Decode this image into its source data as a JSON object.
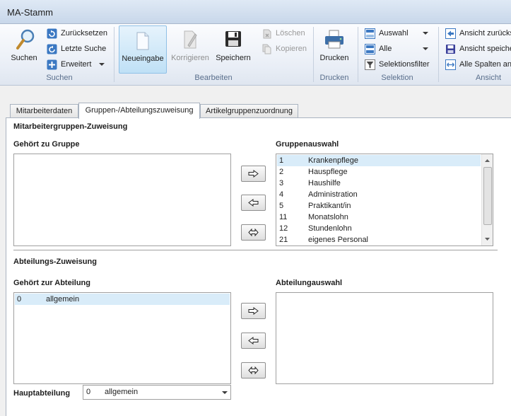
{
  "window": {
    "title": "MA-Stamm"
  },
  "ribbon": {
    "groups": {
      "suchen": "Suchen",
      "bearbeiten": "Bearbeiten",
      "drucken": "Drucken",
      "selektion": "Selektion",
      "ansicht": "Ansicht"
    },
    "buttons": {
      "suchen": "Suchen",
      "zuruecksetzen": "Zurücksetzen",
      "letzte_suche": "Letzte Suche",
      "erweitert": "Erweitert",
      "neueingabe": "Neueingabe",
      "korrigieren": "Korrigieren",
      "speichern": "Speichern",
      "loeschen": "Löschen",
      "kopieren": "Kopieren",
      "drucken": "Drucken",
      "auswahl": "Auswahl",
      "alle": "Alle",
      "selektionsfilter": "Selektionsfilter",
      "ansicht_zurueck": "Ansicht zurücks",
      "ansicht_speichern": "Ansicht speiche",
      "alle_spalten": "Alle Spalten an"
    }
  },
  "tabs": [
    {
      "label": "Mitarbeiterdaten"
    },
    {
      "label": "Gruppen-/Abteilungszuweisung"
    },
    {
      "label": "Artikelgruppenzuordnung"
    }
  ],
  "gruppen": {
    "section_title": "Mitarbeitergruppen-Zuweisung",
    "left_label": "Gehört zu Gruppe",
    "right_label": "Gruppenauswahl",
    "auswahl": [
      {
        "nr": "1",
        "name": "Krankenpflege"
      },
      {
        "nr": "2",
        "name": "Hauspflege"
      },
      {
        "nr": "3",
        "name": "Haushilfe"
      },
      {
        "nr": "4",
        "name": "Administration"
      },
      {
        "nr": "5",
        "name": "Praktikant/in"
      },
      {
        "nr": "11",
        "name": "Monatslohn"
      },
      {
        "nr": "12",
        "name": "Stundenlohn"
      },
      {
        "nr": "21",
        "name": "eigenes Personal"
      }
    ]
  },
  "abteilung": {
    "section_title": "Abteilungs-Zuweisung",
    "left_label": "Gehört zur Abteilung",
    "right_label": "Abteilungauswahl",
    "zugewiesen": [
      {
        "nr": "0",
        "name": "allgemein"
      }
    ],
    "hauptabteilung_label": "Hauptabteilung",
    "hauptabteilung_nr": "0",
    "hauptabteilung_name": "allgemein"
  },
  "icons": {
    "move_right": "arrow-right-icon",
    "move_left": "arrow-left-icon",
    "move_both": "arrow-both-icon"
  }
}
